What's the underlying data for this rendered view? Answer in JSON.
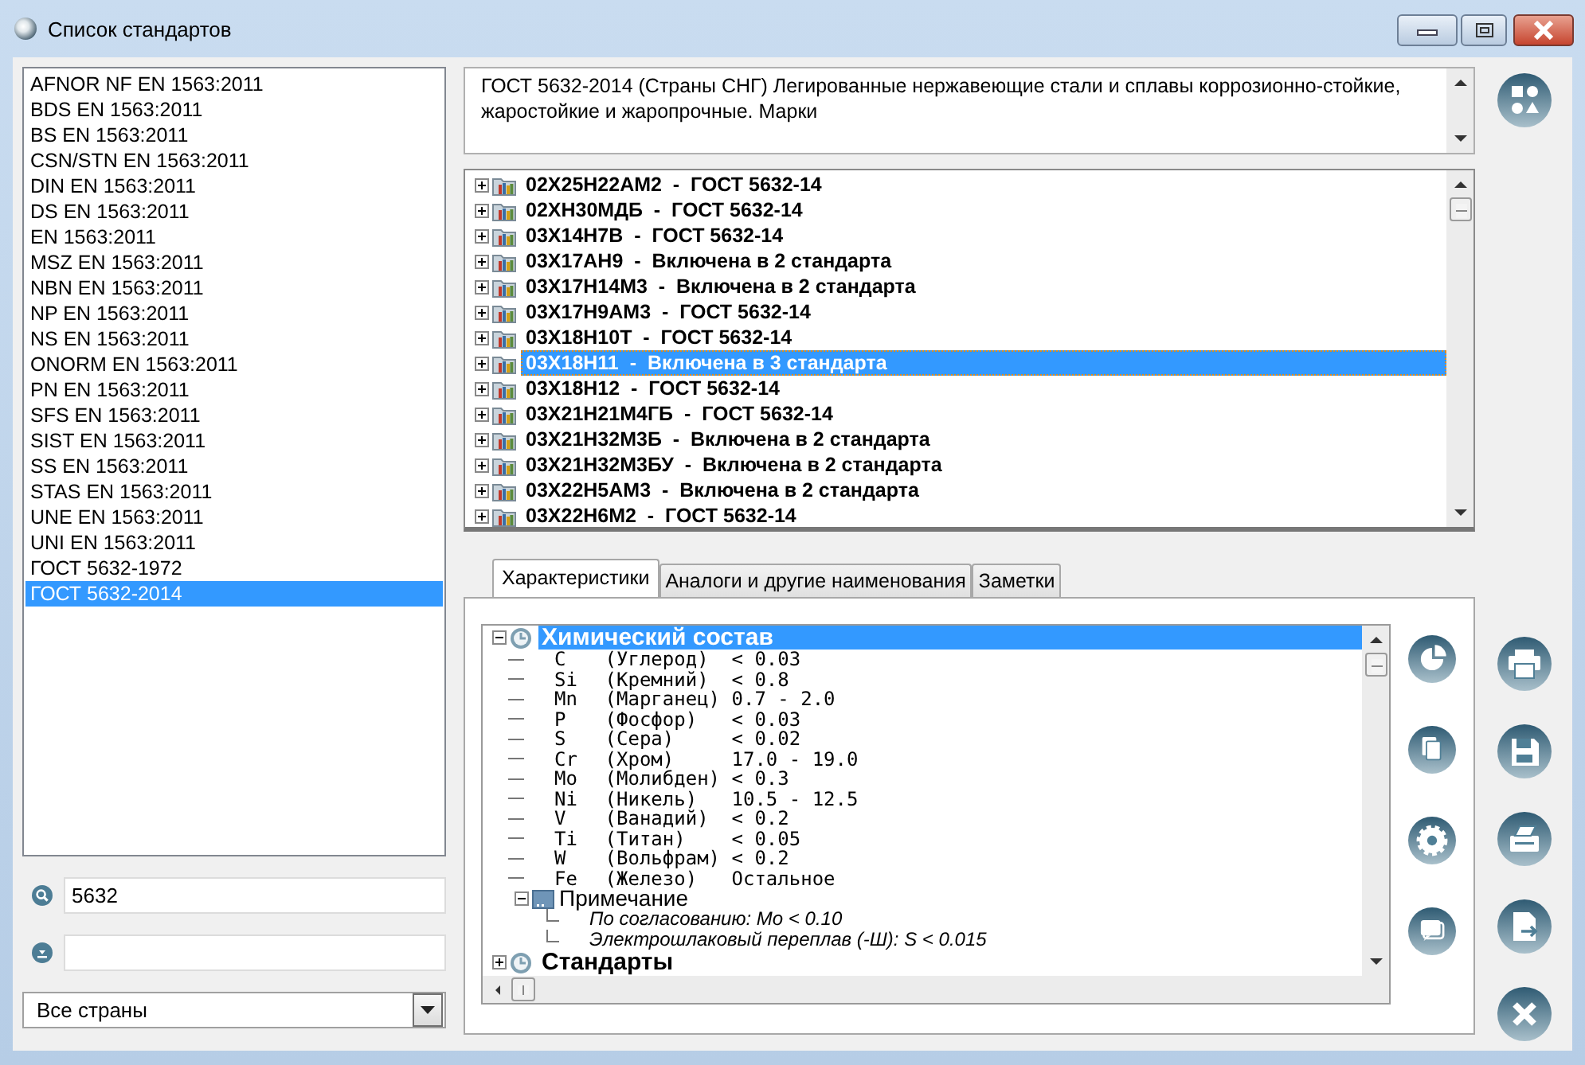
{
  "window": {
    "title": "Список стандартов"
  },
  "standards": {
    "items": [
      {
        "label": "AFNOR NF EN 1563:2011",
        "selected": false
      },
      {
        "label": "BDS EN 1563:2011",
        "selected": false
      },
      {
        "label": "BS EN 1563:2011",
        "selected": false
      },
      {
        "label": "CSN/STN EN 1563:2011",
        "selected": false
      },
      {
        "label": "DIN EN 1563:2011",
        "selected": false
      },
      {
        "label": "DS EN 1563:2011",
        "selected": false
      },
      {
        "label": "EN 1563:2011",
        "selected": false
      },
      {
        "label": "MSZ EN 1563:2011",
        "selected": false
      },
      {
        "label": "NBN EN 1563:2011",
        "selected": false
      },
      {
        "label": "NP EN 1563:2011",
        "selected": false
      },
      {
        "label": "NS EN 1563:2011",
        "selected": false
      },
      {
        "label": "ONORM EN 1563:2011",
        "selected": false
      },
      {
        "label": "PN EN 1563:2011",
        "selected": false
      },
      {
        "label": "SFS EN 1563:2011",
        "selected": false
      },
      {
        "label": "SIST EN 1563:2011",
        "selected": false
      },
      {
        "label": "SS EN 1563:2011",
        "selected": false
      },
      {
        "label": "STAS EN 1563:2011",
        "selected": false
      },
      {
        "label": "UNE EN 1563:2011",
        "selected": false
      },
      {
        "label": "UNI EN 1563:2011",
        "selected": false
      },
      {
        "label": "ГОСТ 5632-1972",
        "selected": false
      },
      {
        "label": "ГОСТ 5632-2014",
        "selected": true
      }
    ]
  },
  "search": {
    "value": "5632"
  },
  "country_select": {
    "value": "Все страны"
  },
  "description": {
    "text": "ГОСТ 5632-2014 (Страны СНГ) Легированные нержавеющие стали и сплавы коррозионно-стойкие, жаростойкие и жаропрочные. Марки"
  },
  "grades": {
    "items": [
      {
        "label": "02Х25Н22АМ2  -  ГОСТ 5632-14",
        "expanded": false,
        "selected": false
      },
      {
        "label": "02ХН30МДБ  -  ГОСТ 5632-14",
        "expanded": false,
        "selected": false
      },
      {
        "label": "03Х14Н7В  -  ГОСТ 5632-14",
        "expanded": false,
        "selected": false
      },
      {
        "label": "03Х17АН9  -  Включена в 2 стандарта",
        "expanded": false,
        "selected": false
      },
      {
        "label": "03Х17Н14М3  -  Включена в 2 стандарта",
        "expanded": false,
        "selected": false
      },
      {
        "label": "03Х17Н9АМ3  -  ГОСТ 5632-14",
        "expanded": false,
        "selected": false
      },
      {
        "label": "03Х18Н10Т  -  ГОСТ 5632-14",
        "expanded": false,
        "selected": false
      },
      {
        "label": "03Х18Н11  -  Включена в 3 стандарта",
        "expanded": false,
        "selected": true
      },
      {
        "label": "03Х18Н12  -  ГОСТ 5632-14",
        "expanded": false,
        "selected": false
      },
      {
        "label": "03Х21Н21М4ГБ  -  ГОСТ 5632-14",
        "expanded": false,
        "selected": false
      },
      {
        "label": "03Х21Н32М3Б  -  Включена в 2 стандарта",
        "expanded": false,
        "selected": false
      },
      {
        "label": "03Х21Н32М3БУ  -  Включена в 2 стандарта",
        "expanded": false,
        "selected": false
      },
      {
        "label": "03Х22Н5АМ3  -  Включена в 2 стандарта",
        "expanded": false,
        "selected": false
      },
      {
        "label": "03Х22Н6М2  -  ГОСТ 5632-14",
        "expanded": false,
        "selected": false
      }
    ]
  },
  "tabs": [
    {
      "label": "Характеристики",
      "selected": true
    },
    {
      "label": "Аналоги и другие наименования",
      "selected": false
    },
    {
      "label": "Заметки",
      "selected": false
    }
  ],
  "properties": {
    "items": [
      {
        "kind": "group",
        "title": "Химический состав",
        "expanded": true,
        "selected": true,
        "children": [
          {
            "kind": "element",
            "symbol": "C",
            "name": "(Углерод)",
            "value": "< 0.03"
          },
          {
            "kind": "element",
            "symbol": "Si",
            "name": "(Кремний)",
            "value": "< 0.8"
          },
          {
            "kind": "element",
            "symbol": "Mn",
            "name": "(Марганец)",
            "value": "0.7 - 2.0"
          },
          {
            "kind": "element",
            "symbol": "P",
            "name": "(Фосфор)",
            "value": "< 0.03"
          },
          {
            "kind": "element",
            "symbol": "S",
            "name": "(Сера)",
            "value": "< 0.02"
          },
          {
            "kind": "element",
            "symbol": "Cr",
            "name": "(Хром)",
            "value": "17.0 - 19.0"
          },
          {
            "kind": "element",
            "symbol": "Mo",
            "name": "(Молибден)",
            "value": "< 0.3"
          },
          {
            "kind": "element",
            "symbol": "Ni",
            "name": "(Никель)",
            "value": "10.5 - 12.5"
          },
          {
            "kind": "element",
            "symbol": "V",
            "name": "(Ванадий)",
            "value": "< 0.2"
          },
          {
            "kind": "element",
            "symbol": "Ti",
            "name": "(Титан)",
            "value": "< 0.05"
          },
          {
            "kind": "element",
            "symbol": "W",
            "name": "(Вольфрам)",
            "value": "< 0.2"
          },
          {
            "kind": "element",
            "symbol": "Fe",
            "name": "(Железо)",
            "value": "Остальное"
          },
          {
            "kind": "note",
            "title": "Примечание",
            "expanded": true,
            "children": [
              {
                "kind": "line",
                "text": "По согласованию: Mo < 0.10"
              },
              {
                "kind": "line",
                "text": "Электрошлаковый переплав (-Ш): S < 0.015"
              }
            ]
          }
        ]
      },
      {
        "kind": "group",
        "title": "Стандарты",
        "expanded": false,
        "selected": false
      }
    ]
  }
}
